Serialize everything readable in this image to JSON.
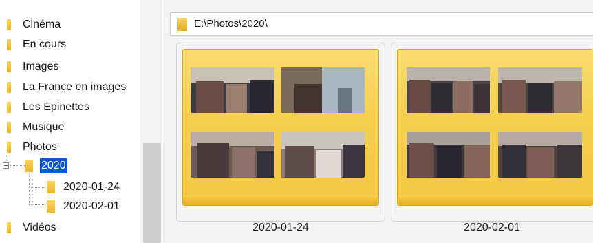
{
  "tree": {
    "items": [
      {
        "label": "Cinéma"
      },
      {
        "label": "En cours"
      },
      {
        "label": "Images"
      },
      {
        "label": "La France en images"
      },
      {
        "label": "Les Epinettes"
      },
      {
        "label": "Musique"
      },
      {
        "label": "Photos"
      },
      {
        "label": "2020",
        "selected": true
      },
      {
        "label": "2020-01-24"
      },
      {
        "label": "2020-02-01"
      },
      {
        "label": "Vidéos"
      }
    ]
  },
  "address_bar": {
    "path": "E:\\Photos\\2020\\",
    "icon": "folder-icon"
  },
  "folders": [
    {
      "name": "2020-01-24"
    },
    {
      "name": "2020-02-01"
    }
  ],
  "colors": {
    "selection": "#0a57d6",
    "folder_yellow": "#f6d052",
    "folder_border": "#d8a823"
  }
}
